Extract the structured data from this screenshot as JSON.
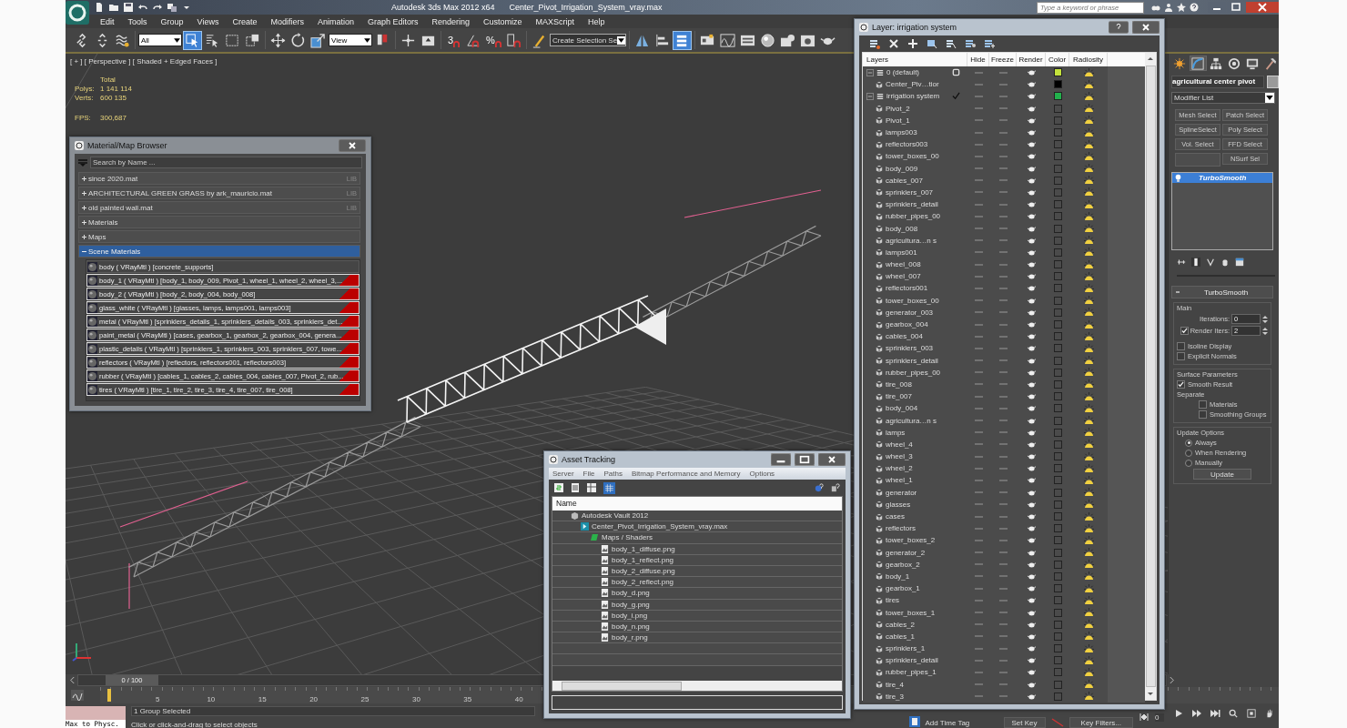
{
  "title_bar": {
    "app": "Autodesk 3ds Max  2012 x64",
    "file": "Center_Pivot_Irrigation_System_vray.max",
    "search": {
      "placeholder": "Type a keyword or phrase"
    }
  },
  "menu": [
    "Edit",
    "Tools",
    "Group",
    "Views",
    "Create",
    "Modifiers",
    "Animation",
    "Graph Editors",
    "Rendering",
    "Customize",
    "MAXScript",
    "Help"
  ],
  "toolbar": [
    {
      "kind": "link",
      "selected": false
    },
    {
      "kind": "unlink",
      "selected": false
    },
    {
      "kind": "bind",
      "selected": false
    },
    {
      "kind": "dropdown",
      "value": "All"
    },
    {
      "kind": "select",
      "selected": true
    },
    {
      "kind": "select-by-name",
      "selected": false
    },
    {
      "kind": "rect-region",
      "selected": false
    },
    {
      "kind": "window-crossing",
      "selected": false
    },
    {
      "kind": "move",
      "selected": false
    },
    {
      "kind": "rotate",
      "selected": false
    },
    {
      "kind": "scale",
      "selected": false
    },
    {
      "kind": "dropdown",
      "value": "View"
    },
    {
      "kind": "pivot",
      "selected": false
    },
    {
      "kind": "manipulate",
      "selected": false
    },
    {
      "kind": "keyboard",
      "selected": false
    },
    {
      "kind": "snap",
      "label": "3",
      "selected": false
    },
    {
      "kind": "angle-snap",
      "selected": false
    },
    {
      "kind": "snap",
      "label": "%",
      "selected": false
    },
    {
      "kind": "spinner-snap",
      "selected": false
    },
    {
      "kind": "edit-named",
      "selected": false
    },
    {
      "kind": "dropdown",
      "value": "Create Selection Se"
    },
    {
      "kind": "mirror",
      "selected": false
    },
    {
      "kind": "align",
      "selected": false
    },
    {
      "kind": "layers",
      "selected": true
    },
    {
      "kind": "ribbon",
      "selected": false
    },
    {
      "kind": "curve",
      "selected": false
    },
    {
      "kind": "schematic",
      "selected": false
    },
    {
      "kind": "material",
      "selected": false
    },
    {
      "kind": "render-setup",
      "selected": false
    },
    {
      "kind": "frame-window",
      "selected": false
    },
    {
      "kind": "teapot",
      "selected": false
    }
  ],
  "viewport": {
    "label": "[ + ] [ Perspective ] [ Shaded + Edged Faces ]",
    "stats_header": "Total",
    "stats": [
      {
        "label": "Polys:",
        "value": "1 141 114"
      },
      {
        "label": "Verts:",
        "value": "600 135"
      }
    ],
    "fps": {
      "label": "FPS:",
      "value": "300,687"
    }
  },
  "material_browser": {
    "title": "Material/Map Browser",
    "search_placeholder": "Search by Name ...",
    "groups": [
      {
        "label": "since 2020.mat",
        "tag": "LIB",
        "expanded": false
      },
      {
        "label": "ARCHITECTURAL GREEN GRASS by ark_mauricio.mat",
        "tag": "LIB",
        "expanded": false
      },
      {
        "label": "old painted wall.mat",
        "tag": "LIB",
        "expanded": false
      },
      {
        "label": "Materials",
        "expanded": false
      },
      {
        "label": "Maps",
        "expanded": false
      },
      {
        "label": "Scene Materials",
        "expanded": true,
        "items": [
          {
            "text": "body  ( VRayMtl ) [concrete_supports]",
            "flagged": false
          },
          {
            "text": "body_1  ( VRayMtl ) [body_1, body_009, Pivot_1, wheel_1, wheel_2, wheel_3,...",
            "flagged": true
          },
          {
            "text": "body_2  ( VRayMtl ) [body_2, body_004, body_008]",
            "flagged": true
          },
          {
            "text": "glass_white  ( VRayMtl ) [glasses, lamps, lamps001, lamps003]",
            "flagged": true
          },
          {
            "text": "metal ( VRayMtl ) [sprinklers_details_1, sprinklers_details_003, sprinklers_det...",
            "flagged": true
          },
          {
            "text": "paint_metal  ( VRayMtl ) [cases, gearbox_1, gearbox_2, gearbox_004, genera...",
            "flagged": true
          },
          {
            "text": "plastic_details ( VRayMtl ) [sprinklers_1, sprinklers_003, sprinklers_007, towe...",
            "flagged": true
          },
          {
            "text": "reflectors  ( VRayMtl ) [reflectors, reflectors001, reflectors003]",
            "flagged": true
          },
          {
            "text": "rubber  ( VRayMtl ) [cables_1, cables_2, cables_004, cables_007, Pivot_2, rub...",
            "flagged": true
          },
          {
            "text": "tires  ( VRayMtl ) [tire_1, tire_2, tire_3, tire_4, tire_007, tire_008]",
            "flagged": true
          }
        ]
      }
    ]
  },
  "layer_panel": {
    "title": "Layer: irrigation system",
    "columns": [
      "Layers",
      "Hide",
      "Freeze",
      "Render",
      "Color",
      "Radiosity"
    ],
    "layers": [
      {
        "name": "0 (default)",
        "current": false,
        "expanded": true,
        "color": "#c3e23c",
        "children": [
          {
            "name": "Center_Piv…tior",
            "color": "#000000"
          }
        ]
      },
      {
        "name": "irrigation system",
        "current": true,
        "expanded": true,
        "color": "#22b14c",
        "children": [
          {
            "name": "Pivot_2"
          },
          {
            "name": "Pivot_1"
          },
          {
            "name": "lamps003"
          },
          {
            "name": "reflectors003"
          },
          {
            "name": "tower_boxes_00"
          },
          {
            "name": "body_009"
          },
          {
            "name": "cables_007"
          },
          {
            "name": "sprinklers_007"
          },
          {
            "name": "sprinklers_detail"
          },
          {
            "name": "rubber_pipes_00"
          },
          {
            "name": "body_008"
          },
          {
            "name": "agricultura…n s"
          },
          {
            "name": "lamps001"
          },
          {
            "name": "wheel_008"
          },
          {
            "name": "wheel_007"
          },
          {
            "name": "reflectors001"
          },
          {
            "name": "tower_boxes_00"
          },
          {
            "name": "generator_003"
          },
          {
            "name": "gearbox_004"
          },
          {
            "name": "cables_004"
          },
          {
            "name": "sprinklers_003"
          },
          {
            "name": "sprinklers_detail"
          },
          {
            "name": "rubber_pipes_00"
          },
          {
            "name": "tire_008"
          },
          {
            "name": "tire_007"
          },
          {
            "name": "body_004"
          },
          {
            "name": "agricultura…n s"
          },
          {
            "name": "lamps"
          },
          {
            "name": "wheel_4"
          },
          {
            "name": "wheel_3"
          },
          {
            "name": "wheel_2"
          },
          {
            "name": "wheel_1"
          },
          {
            "name": "generator"
          },
          {
            "name": "glasses"
          },
          {
            "name": "cases"
          },
          {
            "name": "reflectors"
          },
          {
            "name": "tower_boxes_2"
          },
          {
            "name": "generator_2"
          },
          {
            "name": "gearbox_2"
          },
          {
            "name": "body_1"
          },
          {
            "name": "gearbox_1"
          },
          {
            "name": "tires"
          },
          {
            "name": "tower_boxes_1"
          },
          {
            "name": "cables_2"
          },
          {
            "name": "cables_1"
          },
          {
            "name": "sprinklers_1"
          },
          {
            "name": "sprinklers_detail"
          },
          {
            "name": "rubber_pipes_1"
          },
          {
            "name": "tire_4"
          },
          {
            "name": "tire_3"
          }
        ]
      }
    ]
  },
  "asset_tracking": {
    "title": "Asset Tracking",
    "menu": [
      "Server",
      "File",
      "Paths",
      "Bitmap Performance and Memory",
      "Options"
    ],
    "column": "Name",
    "tree": [
      {
        "name": "Autodesk Vault 2012",
        "kind": "vault",
        "children": [
          {
            "name": "Center_Pivot_Irrigation_System_vray.max",
            "kind": "scene",
            "children": [
              {
                "name": "Maps / Shaders",
                "kind": "maps",
                "children": [
                  {
                    "name": "body_1_diffuse.png",
                    "kind": "bitmap"
                  },
                  {
                    "name": "body_1_reflect.png",
                    "kind": "bitmap"
                  },
                  {
                    "name": "body_2_diffuse.png",
                    "kind": "bitmap"
                  },
                  {
                    "name": "body_2_reflect.png",
                    "kind": "bitmap"
                  },
                  {
                    "name": "body_d.png",
                    "kind": "bitmap"
                  },
                  {
                    "name": "body_g.png",
                    "kind": "bitmap"
                  },
                  {
                    "name": "body_i.png",
                    "kind": "bitmap"
                  },
                  {
                    "name": "body_n.png",
                    "kind": "bitmap"
                  },
                  {
                    "name": "body_r.png",
                    "kind": "bitmap"
                  }
                ]
              }
            ]
          }
        ]
      }
    ]
  },
  "command_panel": {
    "tabs": [
      {
        "kind": "create",
        "selected": false
      },
      {
        "kind": "modify",
        "selected": true
      },
      {
        "kind": "hierarchy",
        "selected": false
      },
      {
        "kind": "motion",
        "selected": false
      },
      {
        "kind": "display",
        "selected": false
      },
      {
        "kind": "utilities",
        "selected": false
      }
    ],
    "object_name": "agricultural center pivot",
    "modifier_list": "Modifier List",
    "modifier_buttons": [
      "Mesh Select",
      "Patch Select",
      "SplineSelect",
      "Poly Select",
      "Vol. Select",
      "FFD Select",
      "NSurf Sel"
    ],
    "stack": [
      {
        "label": "TurboSmooth",
        "selected": true
      }
    ],
    "rollout": {
      "title": "TurboSmooth",
      "main_label": "Main",
      "iterations": {
        "label": "Iterations:",
        "value": "0"
      },
      "render_iters": {
        "label": "Render Iters:",
        "value": "2",
        "checked": true
      },
      "options": [
        {
          "label": "Isoline Display",
          "checked": false
        },
        {
          "label": "Explicit Normals",
          "checked": false
        }
      ],
      "surface_label": "Surface Parameters",
      "smooth_result": {
        "label": "Smooth Result",
        "checked": true
      },
      "separate_label": "Separate",
      "separate": [
        {
          "label": "Materials",
          "checked": false
        },
        {
          "label": "Smoothing Groups",
          "checked": false
        }
      ],
      "update_label": "Update Options",
      "update_options": [
        {
          "label": "Always",
          "selected": true
        },
        {
          "label": "When Rendering",
          "selected": false
        },
        {
          "label": "Manually",
          "selected": false
        }
      ],
      "update_button": "Update"
    }
  },
  "timeline": {
    "frame": "0 / 100",
    "ticks": [
      "5",
      "10",
      "15",
      "20",
      "25",
      "30",
      "35",
      "40"
    ]
  },
  "status": {
    "listener": "Max to Physc.",
    "selection": "1 Group Selected",
    "prompt": "Click or click-and-drag to select objects",
    "time_tag": "Add Time Tag",
    "set_key": "Set Key",
    "key_filters": "Key Filters...",
    "frame_field": "0"
  }
}
